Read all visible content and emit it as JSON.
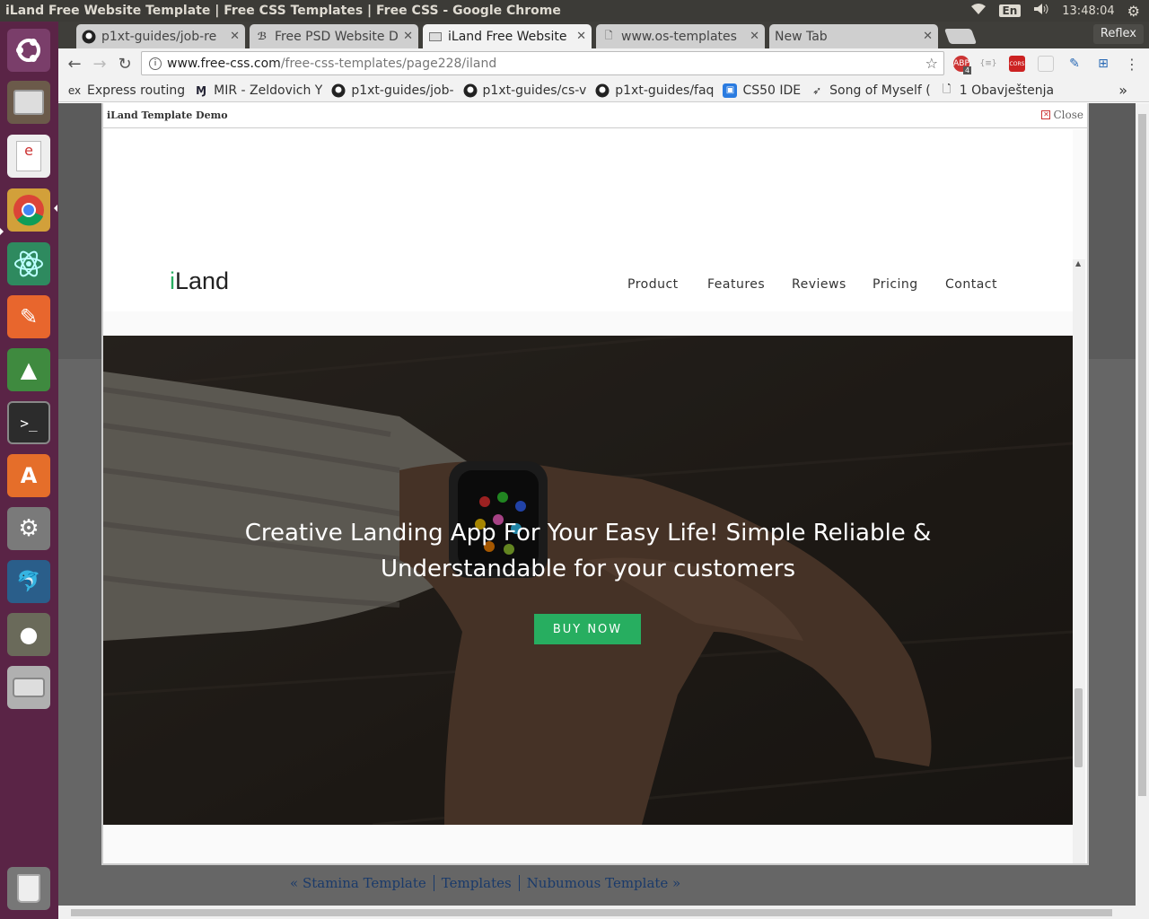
{
  "window": {
    "title": "iLand Free Website Template | Free CSS Templates | Free CSS - Google Chrome"
  },
  "panel": {
    "lang": "En",
    "time": "13:48:04"
  },
  "browser": {
    "profile": "Reflex",
    "tabs": [
      {
        "label": "p1xt-guides/job-re",
        "icon": "github-icon"
      },
      {
        "label": "Free PSD Website D",
        "icon": "page-icon"
      },
      {
        "label": "iLand Free Website",
        "icon": "page-icon"
      },
      {
        "label": "www.os-templates",
        "icon": "document-icon"
      },
      {
        "label": "New Tab",
        "icon": ""
      }
    ],
    "url_host": "www.free-css.com",
    "url_path": "/free-css-templates/page228/iland",
    "extensions": {
      "abp_badge": "4",
      "cors": "CORS"
    },
    "bookmarks": [
      {
        "label": "Express routing",
        "icon": "ex"
      },
      {
        "label": "MIR - Zeldovich Y",
        "icon": "mir-icon"
      },
      {
        "label": "p1xt-guides/job-",
        "icon": "github-icon"
      },
      {
        "label": "p1xt-guides/cs-v",
        "icon": "github-icon"
      },
      {
        "label": "p1xt-guides/faq",
        "icon": "github-icon"
      },
      {
        "label": "CS50 IDE",
        "icon": "cs50-icon"
      },
      {
        "label": "Song of Myself (",
        "icon": "bird-icon"
      },
      {
        "label": "1 Obavještenja",
        "icon": "document-icon"
      }
    ],
    "bookmarks_overflow": "»"
  },
  "demo": {
    "title": "iLand Template Demo",
    "close": "Close",
    "site": {
      "logo_i": "i",
      "logo_rest": "Land",
      "menu": [
        "Product",
        "Features",
        "Reviews",
        "Pricing",
        "Contact"
      ],
      "headline_1": "Creative Landing App For Your Easy Life! Simple Reliable &",
      "headline_2": "Understandable for your customers",
      "cta": "BUY NOW"
    }
  },
  "footer": {
    "prev": "« Stamina Template",
    "mid": "Templates",
    "next": "Nubumous Template »"
  },
  "colors": {
    "accent": "#27ae60",
    "launcher": "#5a2446",
    "panel": "#3c3b37"
  }
}
